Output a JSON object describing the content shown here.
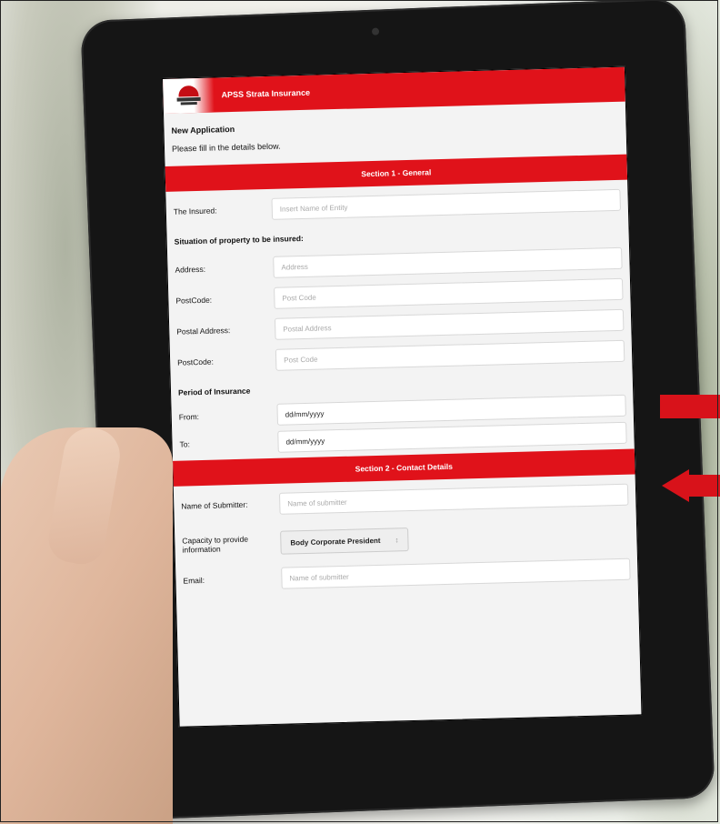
{
  "app": {
    "title": "APSS Strata Insurance"
  },
  "intro": {
    "heading": "New Application",
    "subtext": "Please fill in the details below."
  },
  "section1": {
    "title": "Section 1 - General",
    "insured_label": "The Insured:",
    "insured_placeholder": "Insert Name of Entity",
    "situation_heading": "Situation of property to be insured:",
    "address_label": "Address:",
    "address_placeholder": "Address",
    "postcode_label": "PostCode:",
    "postcode_placeholder": "Post Code",
    "postal_address_label": "Postal Address:",
    "postal_address_placeholder": "Postal Address",
    "postcode2_label": "PostCode:",
    "postcode2_placeholder": "Post Code",
    "period_heading": "Period of Insurance",
    "from_label": "From:",
    "from_value": "dd/mm/yyyy",
    "to_label": "To:",
    "to_value": "dd/mm/yyyy"
  },
  "section2": {
    "title": "Section 2 - Contact Details",
    "submitter_label": "Name of Submitter:",
    "submitter_placeholder": "Name of submitter",
    "capacity_label": "Capacity to provide information",
    "capacity_value": "Body Corporate President",
    "email_label": "Email:",
    "email_placeholder": "Name of submitter"
  },
  "colors": {
    "brand_red": "#e0121a",
    "arrow_red": "#d8121a",
    "tablet_bezel": "#151515"
  }
}
